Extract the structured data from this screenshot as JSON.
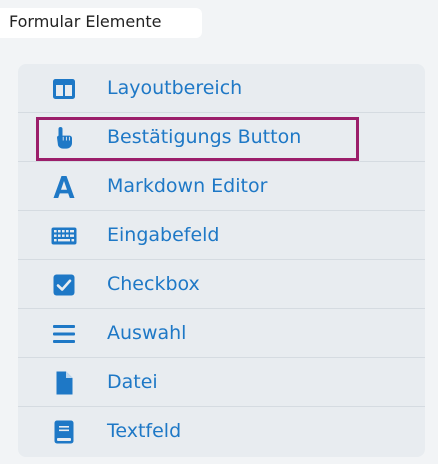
{
  "header": {
    "title": "Formular Elemente"
  },
  "colors": {
    "accent": "#1e78c6",
    "selection_border": "#9b1e6a",
    "panel_background": "#e8ecf0",
    "divider": "#d5dbe1"
  },
  "items": [
    {
      "label": "Layoutbereich",
      "icon": "columns-icon"
    },
    {
      "label": "Bestätigungs Button",
      "icon": "hand-pointer-icon",
      "selected": true
    },
    {
      "label": "Markdown Editor",
      "icon": "font-icon"
    },
    {
      "label": "Eingabefeld",
      "icon": "keyboard-icon"
    },
    {
      "label": "Checkbox",
      "icon": "checkbox-icon"
    },
    {
      "label": "Auswahl",
      "icon": "list-icon"
    },
    {
      "label": "Datei",
      "icon": "file-icon"
    },
    {
      "label": "Textfeld",
      "icon": "book-icon"
    }
  ]
}
